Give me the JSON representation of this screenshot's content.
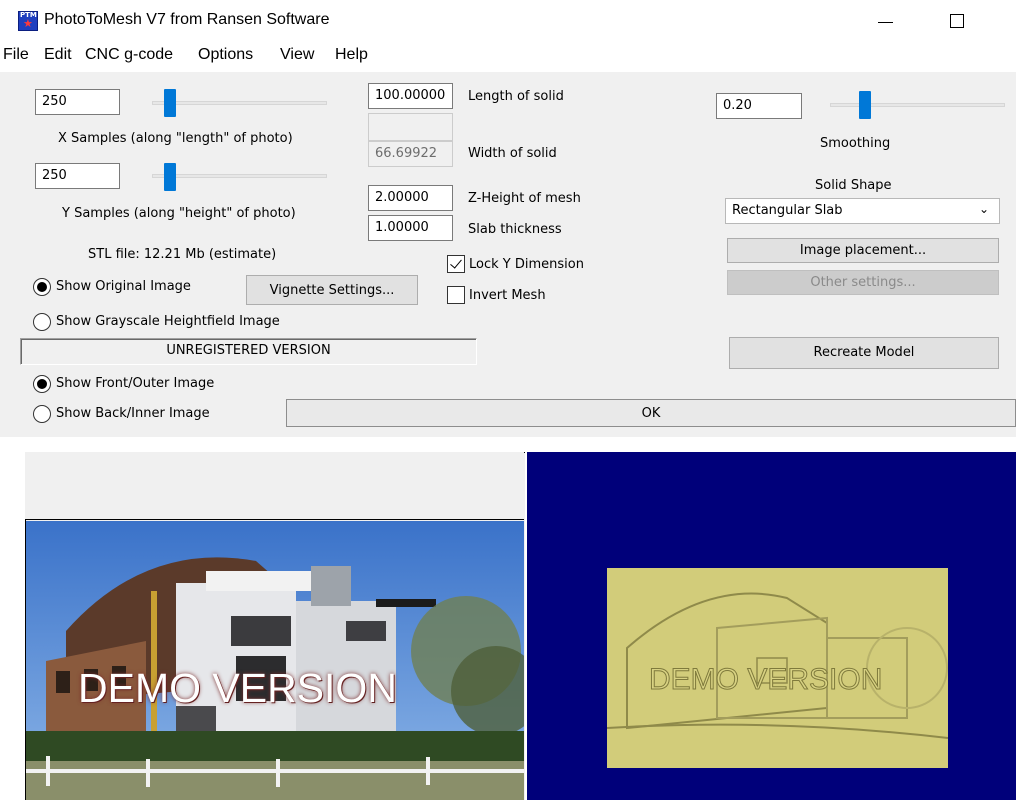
{
  "window": {
    "title": "PhotoToMesh V7 from Ransen Software",
    "icon_text": "PTM"
  },
  "menu": [
    "File",
    "Edit",
    "CNC g-code",
    "Options",
    "View",
    "Help"
  ],
  "samples": {
    "x_value": "250",
    "x_label": "X Samples (along \"length\" of photo)",
    "x_slider_fraction": 0.1,
    "y_value": "250",
    "y_label": "Y Samples (along \"height\" of photo)",
    "y_slider_fraction": 0.1,
    "stl_estimate": "STL file: 12.21 Mb (estimate)"
  },
  "dimensions": {
    "length_value": "100.00000",
    "length_label": "Length of solid",
    "width_value": "66.69922",
    "width_label": "Width of solid",
    "zheight_value": "2.00000",
    "zheight_label": "Z-Height of mesh",
    "slab_value": "1.00000",
    "slab_label": "Slab thickness"
  },
  "checkboxes": {
    "lock_y": {
      "label": "Lock Y Dimension",
      "checked": true
    },
    "invert": {
      "label": "Invert Mesh",
      "checked": false
    }
  },
  "image_mode": {
    "original_label": "Show Original Image",
    "grayscale_label": "Show Grayscale Heightfield Image",
    "selected": "original"
  },
  "vignette_button": "Vignette Settings...",
  "status": "UNREGISTERED VERSION",
  "view_side": {
    "front_label": "Show Front/Outer Image",
    "back_label": "Show Back/Inner Image",
    "selected": "front"
  },
  "ok_button": "OK",
  "smoothing": {
    "value": "0.20",
    "label": "Smoothing",
    "slider_fraction": 0.2
  },
  "solid_shape": {
    "label": "Solid Shape",
    "selected": "Rectangular Slab"
  },
  "image_placement_button": "Image placement...",
  "other_settings_button": "Other settings...",
  "recreate_button": "Recreate Model",
  "photo_watermark": "DEMO VERSION",
  "relief_watermark": "DEMO VERSION",
  "colors": {
    "preview_background": "#00007a",
    "relief_color": "#d2cc7a",
    "accent": "#0078d7"
  }
}
